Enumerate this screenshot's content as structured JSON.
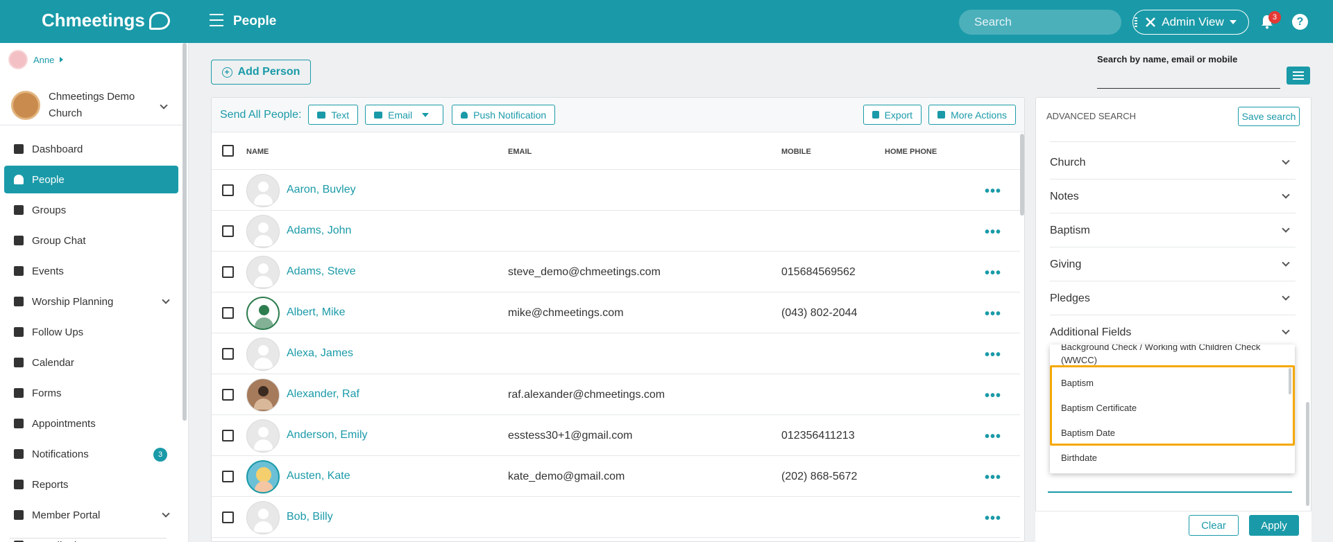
{
  "header": {
    "logo": "Chmeetings",
    "title": "People",
    "search_placeholder": "Search",
    "admin_view": "Admin View",
    "notification_count": "3",
    "help": "?"
  },
  "sidebar": {
    "user": "Anne",
    "church": "Chmeetings Demo Church",
    "items": [
      {
        "label": "Dashboard",
        "icon": "chart-line-icon"
      },
      {
        "label": "People",
        "icon": "person-icon",
        "active": true
      },
      {
        "label": "Groups",
        "icon": "users-icon"
      },
      {
        "label": "Group Chat",
        "icon": "chat-icon"
      },
      {
        "label": "Events",
        "icon": "calendar-small-icon"
      },
      {
        "label": "Worship Planning",
        "icon": "music-icon",
        "expandable": true
      },
      {
        "label": "Follow Ups",
        "icon": "handshake-icon"
      },
      {
        "label": "Calendar",
        "icon": "calendar-icon"
      },
      {
        "label": "Forms",
        "icon": "list-icon"
      },
      {
        "label": "Appointments",
        "icon": "clock-icon"
      },
      {
        "label": "Notifications",
        "icon": "bell-icon",
        "badge": "3"
      },
      {
        "label": "Reports",
        "icon": "report-icon"
      },
      {
        "label": "Member Portal",
        "icon": "phone-icon",
        "expandable": true
      },
      {
        "label": "Contributions",
        "icon": "money-icon",
        "expandable": true
      }
    ]
  },
  "main": {
    "add_person": "Add Person",
    "quick_search_label": "Search by name, email or mobile",
    "toolbar": {
      "send_all": "Send All People:",
      "text": "Text",
      "email": "Email",
      "push": "Push Notification",
      "export": "Export",
      "more_actions": "More Actions"
    },
    "columns": [
      "NAME",
      "EMAIL",
      "MOBILE",
      "HOME PHONE"
    ],
    "rows": [
      {
        "name": "Aaron, Buvley",
        "email": "",
        "mobile": "",
        "avatar": "default"
      },
      {
        "name": "Adams, John",
        "email": "",
        "mobile": "",
        "avatar": "default"
      },
      {
        "name": "Adams, Steve",
        "email": "steve_demo@chmeetings.com",
        "mobile": "015684569562",
        "avatar": "default"
      },
      {
        "name": "Albert, Mike",
        "email": "mike@chmeetings.com",
        "mobile": "(043) 802-2044",
        "avatar": "green"
      },
      {
        "name": "Alexa, James",
        "email": "",
        "mobile": "",
        "avatar": "default"
      },
      {
        "name": "Alexander, Raf",
        "email": "raf.alexander@chmeetings.com",
        "mobile": "",
        "avatar": "man"
      },
      {
        "name": "Anderson, Emily",
        "email": "esstess30+1@gmail.com",
        "mobile": "012356411213",
        "avatar": "default"
      },
      {
        "name": "Austen, Kate",
        "email": "kate_demo@gmail.com",
        "mobile": "(202) 868-5672",
        "avatar": "girl"
      },
      {
        "name": "Bob, Billy",
        "email": "",
        "mobile": "",
        "avatar": "default"
      }
    ]
  },
  "advanced_search": {
    "title": "ADVANCED SEARCH",
    "save_search": "Save search",
    "sections": [
      "Church",
      "Notes",
      "Baptism",
      "Giving",
      "Pledges",
      "Additional Fields"
    ],
    "dropdown_partial": "Background Check / Working with Children Check (WWCC)",
    "dropdown_items": [
      "Baptism",
      "Baptism Certificate",
      "Baptism Date",
      "Birthdate"
    ],
    "clear": "Clear",
    "apply": "Apply"
  },
  "colors": {
    "accent": "#1a9aa8",
    "highlight": "#f5a800",
    "badge": "#e53935"
  }
}
